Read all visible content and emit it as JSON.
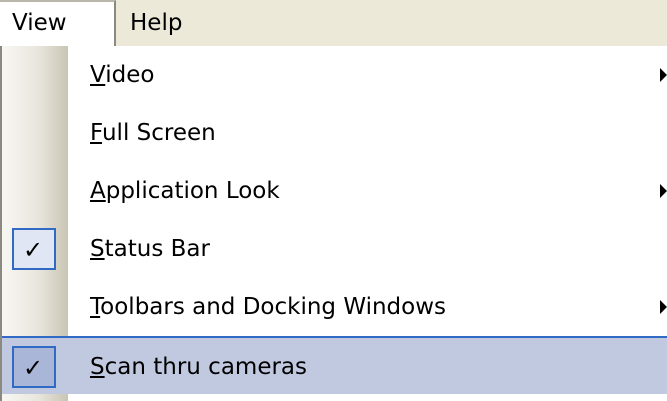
{
  "menubar": {
    "items": [
      {
        "label": "View"
      },
      {
        "label": "Help"
      }
    ]
  },
  "view_menu": {
    "items": [
      {
        "pre": "",
        "mnemonic": "V",
        "post": "ideo",
        "label": "Video",
        "has_submenu": true,
        "checked": false
      },
      {
        "pre": "",
        "mnemonic": "F",
        "post": "ull Screen",
        "label": "Full Screen",
        "has_submenu": false,
        "checked": false
      },
      {
        "pre": "",
        "mnemonic": "A",
        "post": "pplication Look",
        "label": "Application Look",
        "has_submenu": true,
        "checked": false
      },
      {
        "pre": "",
        "mnemonic": "S",
        "post": "tatus Bar",
        "label": "Status Bar",
        "has_submenu": false,
        "checked": true
      },
      {
        "pre": "",
        "mnemonic": "T",
        "post": "oolbars and Docking Windows",
        "label": "Toolbars and Docking Windows",
        "has_submenu": true,
        "checked": false
      },
      {
        "pre": "",
        "mnemonic": "S",
        "post": "can thru cameras",
        "label": "Scan thru cameras",
        "has_submenu": false,
        "checked": true,
        "highlighted": true
      }
    ],
    "check_glyph": "✓",
    "arrow_icon": "submenu-arrow-icon"
  },
  "colors": {
    "menubar_bg": "#ece9d8",
    "highlight_bg": "#c1c9e0",
    "highlight_border": "#316ac5"
  }
}
